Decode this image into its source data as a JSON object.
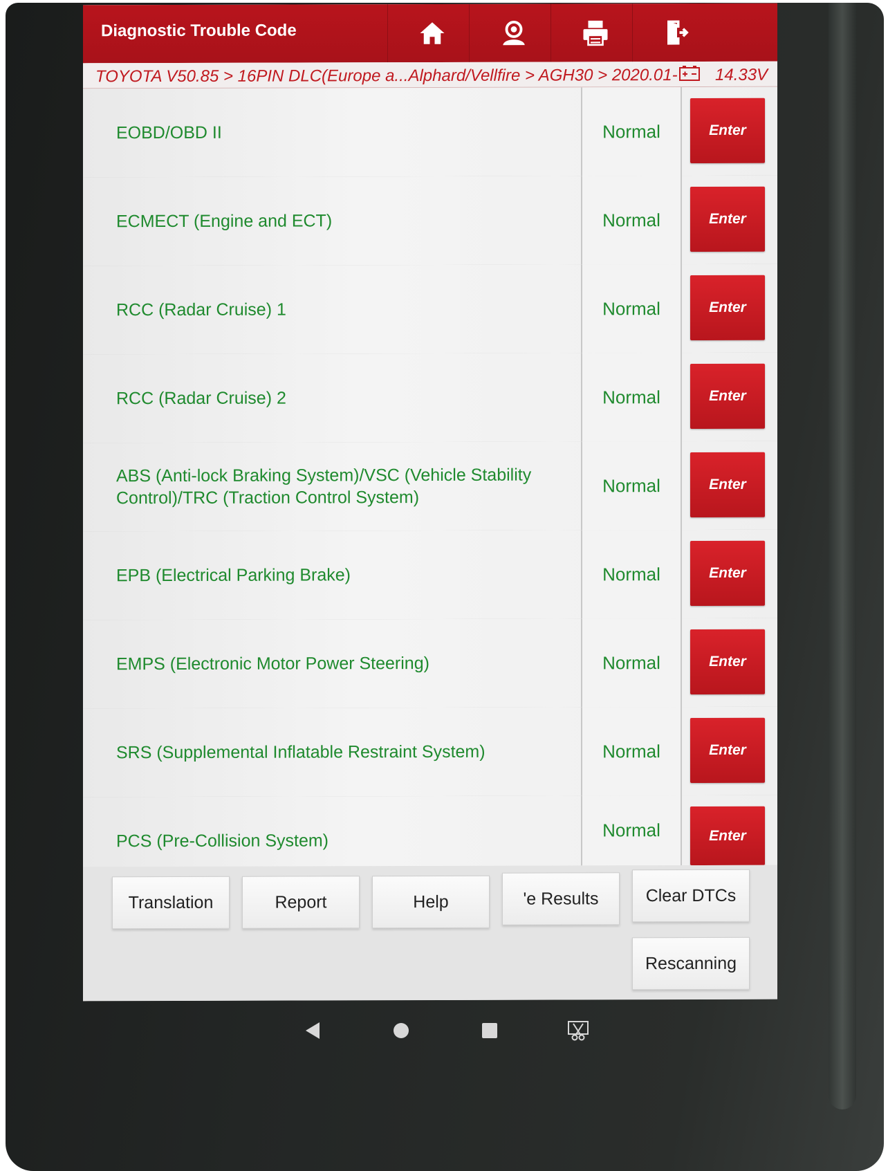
{
  "header": {
    "title": "Diagnostic Trouble Code",
    "icons": [
      "home-icon",
      "user-icon",
      "printer-icon",
      "exit-icon"
    ]
  },
  "breadcrumb": {
    "path": "TOYOTA V50.85 > 16PIN DLC(Europe a...Alphard/Vellfire > AGH30 > 2020.01-",
    "voltage": "14.33V"
  },
  "systems": [
    {
      "name": "EOBD/OBD II",
      "status": "Normal",
      "action": "Enter"
    },
    {
      "name": "ECMECT (Engine and ECT)",
      "status": "Normal",
      "action": "Enter"
    },
    {
      "name": "RCC (Radar Cruise) 1",
      "status": "Normal",
      "action": "Enter"
    },
    {
      "name": "RCC (Radar Cruise) 2",
      "status": "Normal",
      "action": "Enter"
    },
    {
      "name": "ABS (Anti-lock Braking System)/VSC (Vehicle Stability Control)/TRC (Traction Control System)",
      "status": "Normal",
      "action": "Enter"
    },
    {
      "name": "EPB (Electrical Parking Brake)",
      "status": "Normal",
      "action": "Enter"
    },
    {
      "name": "EMPS (Electronic Motor Power Steering)",
      "status": "Normal",
      "action": "Enter"
    },
    {
      "name": "SRS (Supplemental Inflatable Restraint System)",
      "status": "Normal",
      "action": "Enter"
    },
    {
      "name": "PCS (Pre-Collision System)",
      "status": "Normal",
      "action": "Enter"
    }
  ],
  "footer": {
    "translation": "Translation",
    "report": "Report",
    "help": "Help",
    "save_results": "'e Results",
    "clear_dtcs": "Clear DTCs",
    "rescanning": "Rescanning"
  },
  "colors": {
    "header_red": "#b8141c",
    "text_green": "#1f8a2e",
    "breadcrumb_red": "#c0191f"
  }
}
